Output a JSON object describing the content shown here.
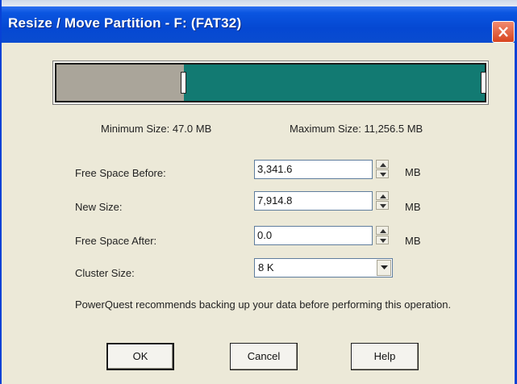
{
  "window": {
    "title": "Resize / Move Partition - F:  (FAT32)"
  },
  "partition_map": {
    "free_before_fraction": 0.297,
    "used_fraction": 0.703,
    "colors": {
      "free": "#aaa59a",
      "used": "#127a72"
    }
  },
  "limits": {
    "minimum": "Minimum Size:  47.0 MB",
    "maximum": "Maximum Size:  11,256.5 MB"
  },
  "form": {
    "free_space_before": {
      "label": "Free Space Before:",
      "value": "3,341.6",
      "unit": "MB"
    },
    "new_size": {
      "label": "New Size:",
      "value": "7,914.8",
      "unit": "MB"
    },
    "free_space_after": {
      "label": "Free Space After:",
      "value": "0.0",
      "unit": "MB"
    },
    "cluster_size": {
      "label": "Cluster Size:",
      "value": "8 K"
    }
  },
  "note": "PowerQuest recommends backing up your data before performing this operation.",
  "buttons": {
    "ok": "OK",
    "cancel": "Cancel",
    "help": "Help"
  }
}
